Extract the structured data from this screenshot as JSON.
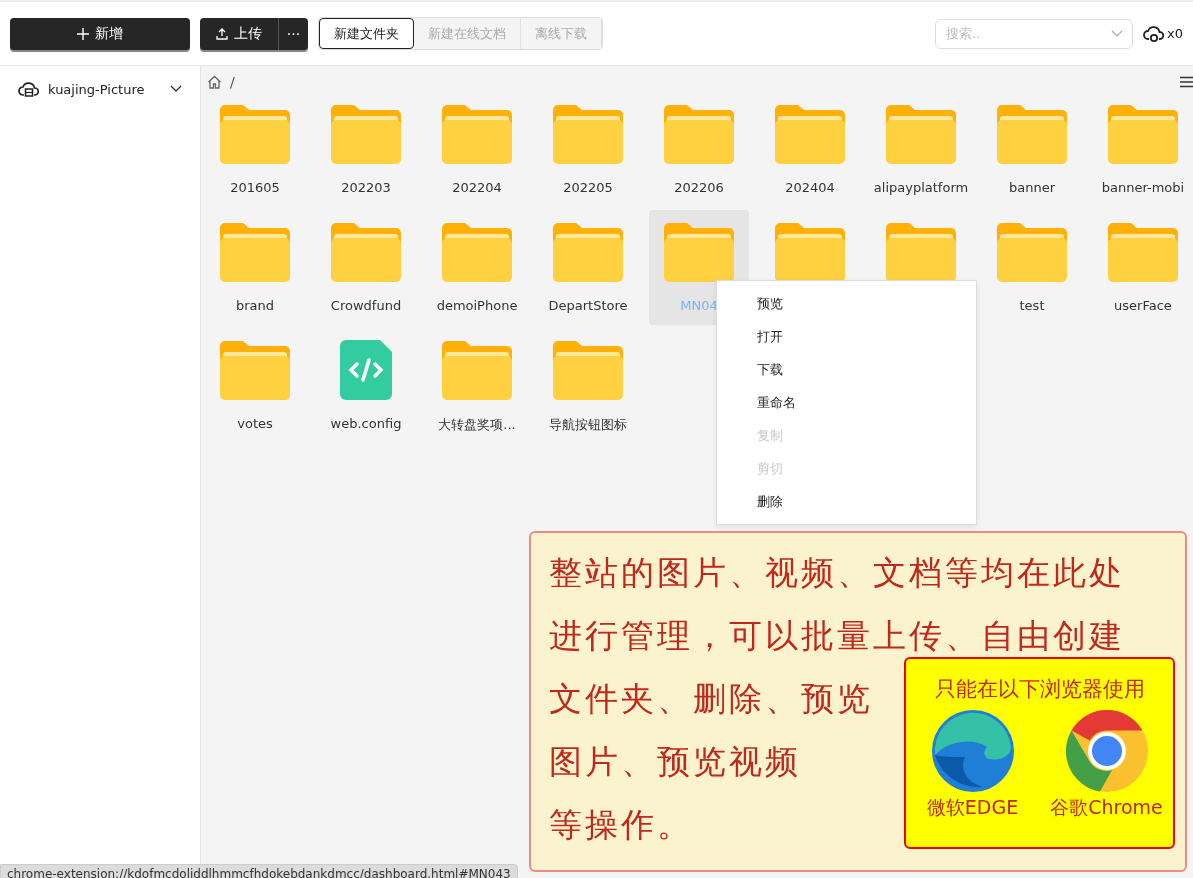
{
  "toolbar": {
    "new_button": "新增",
    "upload_button": "上传",
    "more_button": "···",
    "actions": [
      {
        "label": "新建文件夹",
        "disabled": false
      },
      {
        "label": "新建在线文档",
        "disabled": true
      },
      {
        "label": "离线下载",
        "disabled": true
      }
    ],
    "search": {
      "placeholder": "搜索.."
    },
    "upload_count": "x0"
  },
  "sidebar": {
    "storage": "kuajing-Picture"
  },
  "breadcrumb": "/",
  "files": [
    {
      "kind": "folder",
      "name": "201605",
      "selected": false
    },
    {
      "kind": "folder",
      "name": "202203",
      "selected": false
    },
    {
      "kind": "folder",
      "name": "202204",
      "selected": false
    },
    {
      "kind": "folder",
      "name": "202205",
      "selected": false
    },
    {
      "kind": "folder",
      "name": "202206",
      "selected": false
    },
    {
      "kind": "folder",
      "name": "202404",
      "selected": false
    },
    {
      "kind": "folder",
      "name": "alipayplatform",
      "selected": false
    },
    {
      "kind": "folder",
      "name": "banner",
      "selected": false
    },
    {
      "kind": "folder",
      "name": "banner-mobi",
      "selected": false
    },
    {
      "kind": "folder",
      "name": "brand",
      "selected": false
    },
    {
      "kind": "folder",
      "name": "Crowdfund",
      "selected": false
    },
    {
      "kind": "folder",
      "name": "demoiPhone",
      "selected": false
    },
    {
      "kind": "folder",
      "name": "DepartStore",
      "selected": false
    },
    {
      "kind": "folder",
      "name": "MN04",
      "selected": true
    },
    {
      "kind": "folder",
      "selected": false
    },
    {
      "kind": "folder",
      "selected": false
    },
    {
      "kind": "folder",
      "name": "test",
      "selected": false
    },
    {
      "kind": "folder",
      "name": "userFace",
      "selected": false
    },
    {
      "kind": "folder",
      "name": "votes",
      "selected": false
    },
    {
      "kind": "file",
      "name": "web.config",
      "selected": false
    },
    {
      "kind": "folder",
      "name": "大转盘奖项...",
      "selected": false
    },
    {
      "kind": "folder",
      "name": "导航按钮图标",
      "selected": false
    }
  ],
  "context_menu": [
    {
      "label": "预览",
      "disabled": false
    },
    {
      "label": "打开",
      "disabled": false
    },
    {
      "label": "下载",
      "disabled": false
    },
    {
      "label": "重命名",
      "disabled": false
    },
    {
      "label": "复制",
      "disabled": true
    },
    {
      "label": "剪切",
      "disabled": true
    },
    {
      "label": "删除",
      "disabled": false
    }
  ],
  "annotation": {
    "lines": [
      "整站的图片、视频、文档等均在此处",
      "进行管理，可以批量上传、自由创建",
      "文件夹、删除、预览",
      "图片、预览视频",
      "等操作。"
    ],
    "browsers": {
      "title": "只能在以下浏览器使用",
      "items": [
        {
          "kind": "edge",
          "name": "微软EDGE"
        },
        {
          "kind": "chrome",
          "name": "谷歌Chrome"
        }
      ]
    }
  },
  "status_url": "chrome-extension://kdofmcdoliddlhmmcfhdokebdankdmcc/dashboard.html#MN043"
}
